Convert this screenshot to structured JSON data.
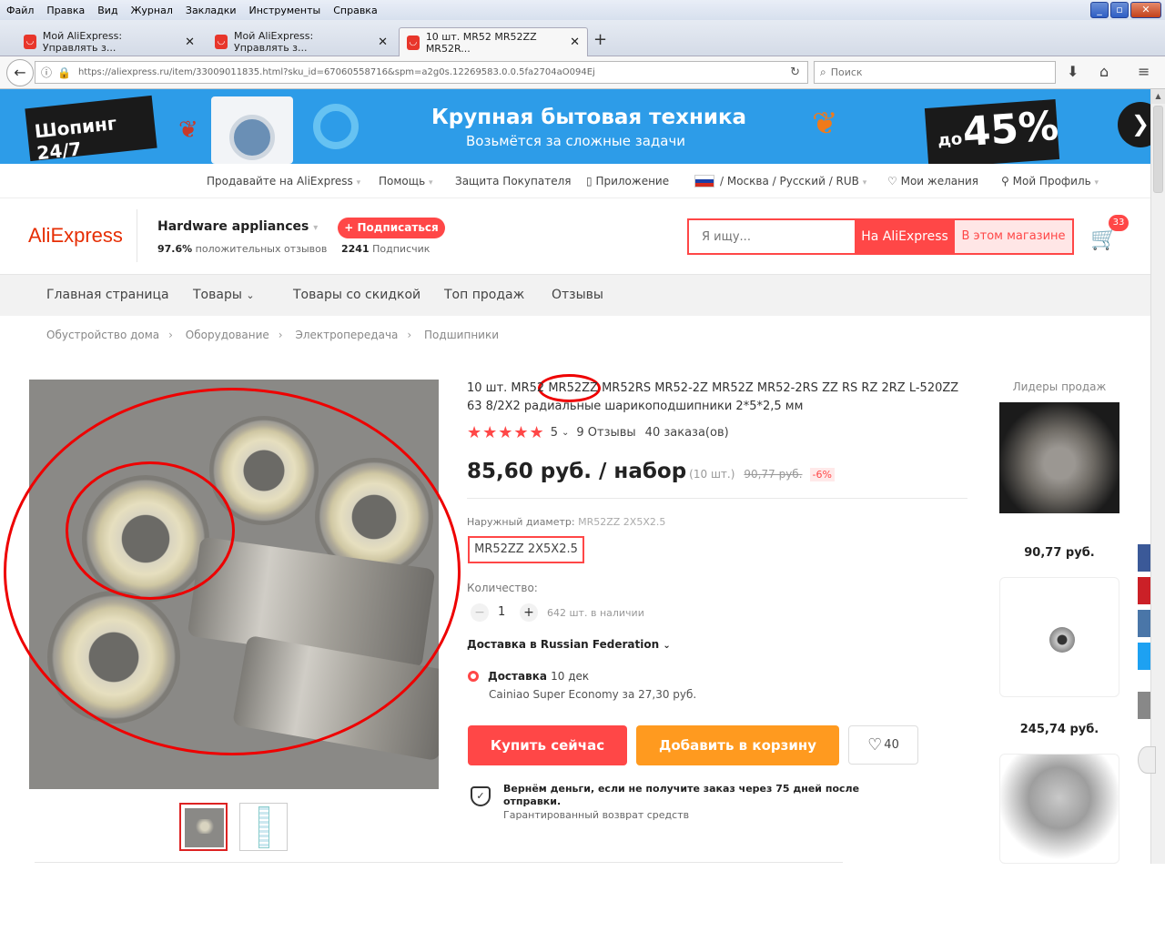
{
  "browser": {
    "menu": [
      "Файл",
      "Правка",
      "Вид",
      "Журнал",
      "Закладки",
      "Инструменты",
      "Справка"
    ],
    "tabs": [
      {
        "title": "Мой AliExpress: Управлять з..."
      },
      {
        "title": "Мой AliExpress: Управлять з..."
      },
      {
        "title": "10 шт. MR52 MR52ZZ MR52R..."
      }
    ],
    "url": "https://aliexpress.ru/item/33009011835.html?sku_id=67060558716&spm=a2g0s.12269583.0.0.5fa2704aO094Ej",
    "search_placeholder": "Поиск"
  },
  "banner": {
    "badge": "Шопинг 24/7",
    "title": "Крупная бытовая техника",
    "subtitle": "Возьмётся за сложные задачи",
    "discount_prefix": "до",
    "discount": "45%"
  },
  "topnav": {
    "sell": "Продавайте на AliExpress",
    "help": "Помощь",
    "protection": "Защита Покупателя",
    "app": "Приложение",
    "region": "/ Москва / Русский / RUB",
    "wishlist": "Мои желания",
    "profile": "Мой Профиль"
  },
  "header": {
    "logo": "AliExpress",
    "store_name": "Hardware appliances",
    "feedback_pct": "97.6%",
    "feedback_text": "положительных отзывов",
    "subscribe": "+ Подписаться",
    "subscribers_count": "2241",
    "subscribers_text": "Подписчик",
    "search_placeholder": "Я ищу...",
    "search_all": "На AliExpress",
    "search_store": "В этом магазине",
    "cart_count": "33"
  },
  "storenav": [
    "Главная страница",
    "Товары",
    "Товары со скидкой",
    "Топ продаж",
    "Отзывы"
  ],
  "breadcrumbs": [
    "Обустройство дома",
    "Оборудование",
    "Электропередача",
    "Подшипники"
  ],
  "product": {
    "title": "10 шт. MR52 MR52ZZ MR52RS MR52-2Z MR52Z MR52-2RS ZZ RS RZ 2RZ L-520ZZ 63 8/2X2 радиальные шарикоподшипники 2*5*2,5 мм",
    "rating": "5",
    "reviews": "9 Отзывы",
    "orders": "40 заказа(ов)",
    "price": "85,60 руб. / набор",
    "unit": "(10 шт.)",
    "old_price": "90,77 руб.",
    "discount": "-6%",
    "option_label": "Наружный диаметр:",
    "option_value": "MR52ZZ 2X5X2.5",
    "option_selected": "MR52ZZ 2X5X2.5",
    "qty_label": "Количество:",
    "qty": "1",
    "available": "642 шт. в наличии",
    "ship_to": "Доставка в Russian Federation",
    "delivery_label": "Доставка",
    "delivery_date": "10 дек",
    "carrier": "Cainiao Super Economy за 27,30 руб.",
    "buy_now": "Купить сейчас",
    "add_to_cart": "Добавить в корзину",
    "wish_count": "40",
    "guarantee": "Вернём деньги, если не получите заказ через 75 дней после отправки.",
    "guarantee_sub": "Гарантированный возврат средств"
  },
  "sidebar": {
    "heading": "Лидеры продаж",
    "prices": [
      "90,77 руб.",
      "245,74 руб."
    ]
  },
  "colors": {
    "accent": "#ff4747",
    "cta_orange": "#ff9a1f",
    "banner": "#2d9ce8"
  }
}
